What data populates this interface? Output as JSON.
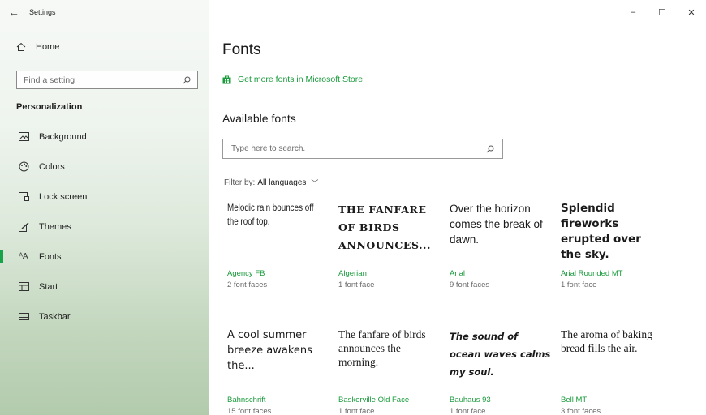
{
  "window": {
    "title": "Settings",
    "back_icon": "arrow-left-icon",
    "controls": {
      "minimize": "–",
      "maximize": "☐",
      "close": "✕"
    }
  },
  "sidebar": {
    "home_label": "Home",
    "search_placeholder": "Find a setting",
    "section_title": "Personalization",
    "items": [
      {
        "label": "Background",
        "icon": "picture-icon"
      },
      {
        "label": "Colors",
        "icon": "palette-icon"
      },
      {
        "label": "Lock screen",
        "icon": "lock-screen-icon"
      },
      {
        "label": "Themes",
        "icon": "themes-icon"
      },
      {
        "label": "Fonts",
        "icon": "fonts-icon",
        "active": true
      },
      {
        "label": "Start",
        "icon": "start-icon"
      },
      {
        "label": "Taskbar",
        "icon": "taskbar-icon"
      }
    ]
  },
  "main": {
    "title": "Fonts",
    "store_link": "Get more fonts in Microsoft Store",
    "available_heading": "Available fonts",
    "search_placeholder": "Type here to search.",
    "filter_label": "Filter by:",
    "filter_value": "All languages",
    "fonts": [
      {
        "sample": "Melodic rain bounces off the roof top.",
        "name": "Agency FB",
        "faces": "2 font faces"
      },
      {
        "sample": "THE FANFARE OF BIRDS ANNOUNCES...",
        "name": "Algerian",
        "faces": "1 font face"
      },
      {
        "sample": "Over the horizon comes the break of dawn.",
        "name": "Arial",
        "faces": "9 font faces"
      },
      {
        "sample": "Splendid fireworks erupted over the sky.",
        "name": "Arial Rounded MT",
        "faces": "1 font face"
      },
      {
        "sample": "A cool summer breeze awakens the...",
        "name": "Bahnschrift",
        "faces": "15 font faces"
      },
      {
        "sample": "The fanfare of birds announces the morning.",
        "name": "Baskerville Old Face",
        "faces": "1 font face"
      },
      {
        "sample": "The sound of ocean waves calms my soul.",
        "name": "Bauhaus 93",
        "faces": "1 font face"
      },
      {
        "sample": "The aroma of baking bread fills the air.",
        "name": "Bell MT",
        "faces": "3 font faces"
      }
    ]
  },
  "colors": {
    "accent": "#1a9b3c",
    "active_indicator": "#16a34a"
  }
}
